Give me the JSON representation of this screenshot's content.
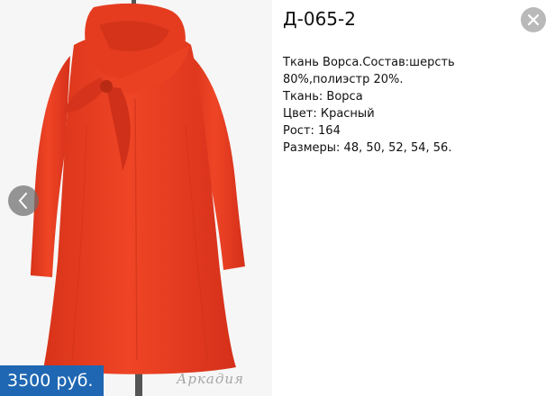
{
  "product": {
    "title": "Д-065-2",
    "price": "3500 руб.",
    "watermark": "Аркадия",
    "description": [
      "Ткань Ворса.Состав:шерсть 80%,полиэстр 20%.",
      "Ткань: Ворса",
      "Цвет: Красный",
      "Рост: 164",
      "Размеры: 48, 50, 52, 54, 56."
    ]
  },
  "controls": {
    "prev_icon": "chevron-left-icon",
    "close_icon": "close-icon"
  },
  "colors": {
    "coat": "#e43a1f",
    "price_bg": "#1f67b3",
    "photo_bg": "#f6f6f6"
  }
}
